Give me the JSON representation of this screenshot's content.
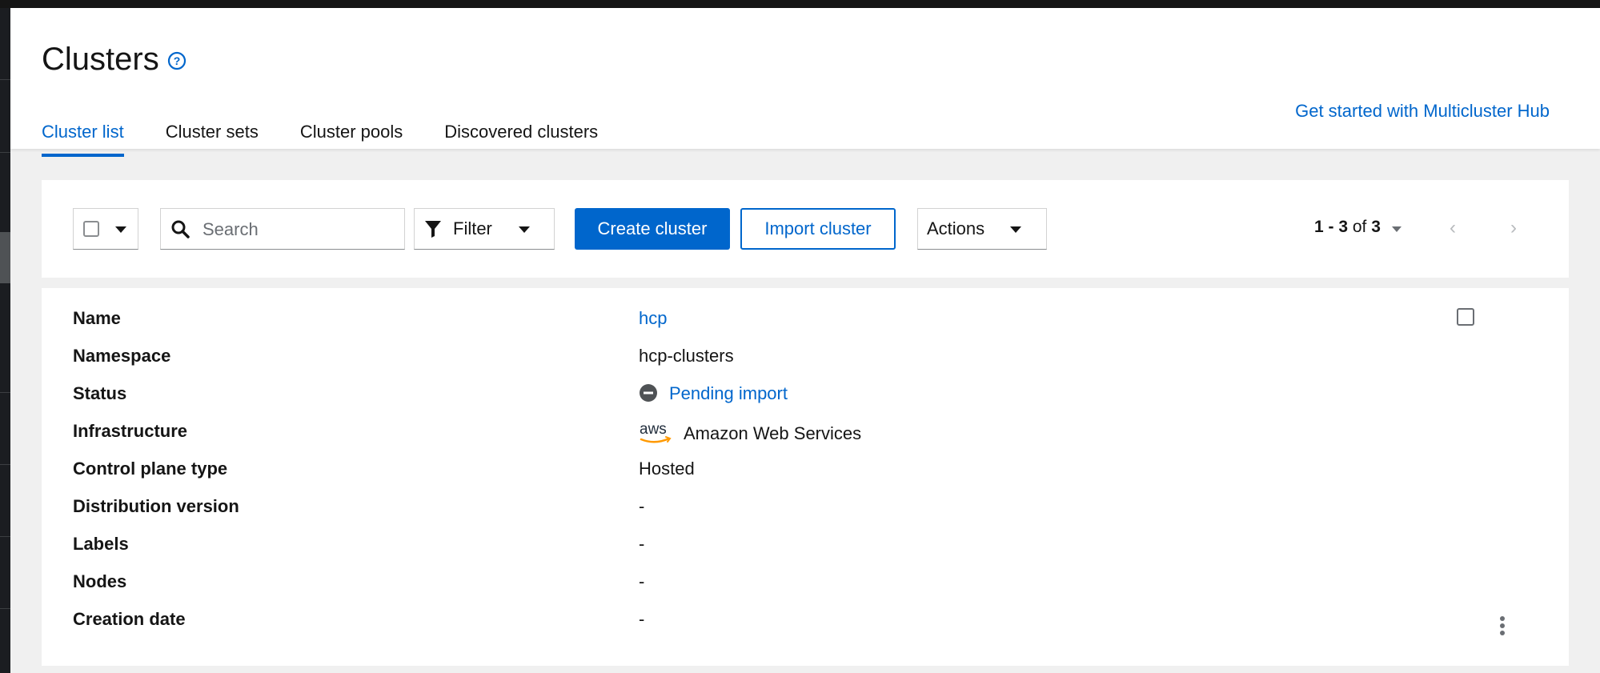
{
  "page": {
    "title": "Clusters",
    "help_icon": "question-circle-icon",
    "get_started_link": "Get started with Multicluster Hub"
  },
  "tabs": [
    {
      "label": "Cluster list",
      "active": true
    },
    {
      "label": "Cluster sets",
      "active": false
    },
    {
      "label": "Cluster pools",
      "active": false
    },
    {
      "label": "Discovered clusters",
      "active": false
    }
  ],
  "toolbar": {
    "search_placeholder": "Search",
    "filter_label": "Filter",
    "create_button": "Create cluster",
    "import_button": "Import cluster",
    "actions_label": "Actions",
    "pagination": {
      "range": "1 - 3",
      "of_text": "of",
      "total": "3"
    }
  },
  "cluster": {
    "fields": [
      {
        "label": "Name",
        "value": "hcp",
        "style": "link"
      },
      {
        "label": "Namespace",
        "value": "hcp-clusters"
      },
      {
        "label": "Status",
        "value": "Pending import",
        "style": "link",
        "icon": "minus-circle-icon"
      },
      {
        "label": "Infrastructure",
        "value": "Amazon Web Services",
        "icon": "aws-logo"
      },
      {
        "label": "Control plane type",
        "value": "Hosted"
      },
      {
        "label": "Distribution version",
        "value": "-"
      },
      {
        "label": "Labels",
        "value": "-"
      },
      {
        "label": "Nodes",
        "value": "-"
      },
      {
        "label": "Creation date",
        "value": "-"
      }
    ]
  },
  "colors": {
    "accent": "#0066cc",
    "text": "#151515",
    "page_background": "#f0f0f0"
  }
}
